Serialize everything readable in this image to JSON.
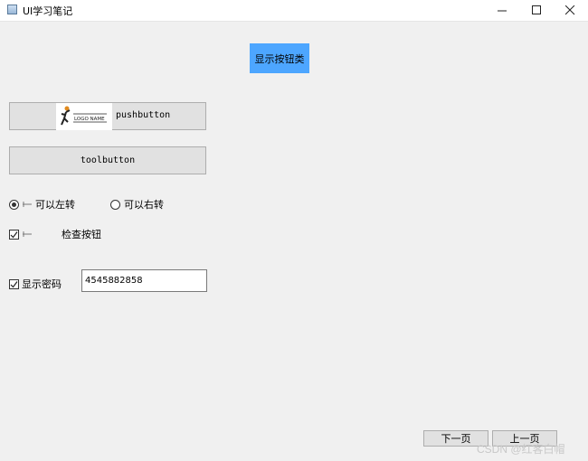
{
  "window": {
    "title": "UI学习笔记",
    "minimize_icon": "minimize-icon",
    "maximize_icon": "maximize-icon",
    "close_icon": "close-icon"
  },
  "show_button": {
    "label": "显示按钮类",
    "color": "#4da6ff"
  },
  "pushbutton": {
    "label": "pushbutton",
    "logo_text": "LOGO NAME"
  },
  "toolbutton": {
    "label": "toolbutton"
  },
  "radios": [
    {
      "label": "可以左转",
      "checked": true
    },
    {
      "label": "可以右转",
      "checked": false
    }
  ],
  "check_button": {
    "label": "检查按钮",
    "checked": true
  },
  "show_password": {
    "label": "显示密码",
    "checked": true,
    "value": "4545882858"
  },
  "nav": {
    "next": "下一页",
    "prev": "上一页"
  },
  "watermark": "CSDN @红客白帽"
}
